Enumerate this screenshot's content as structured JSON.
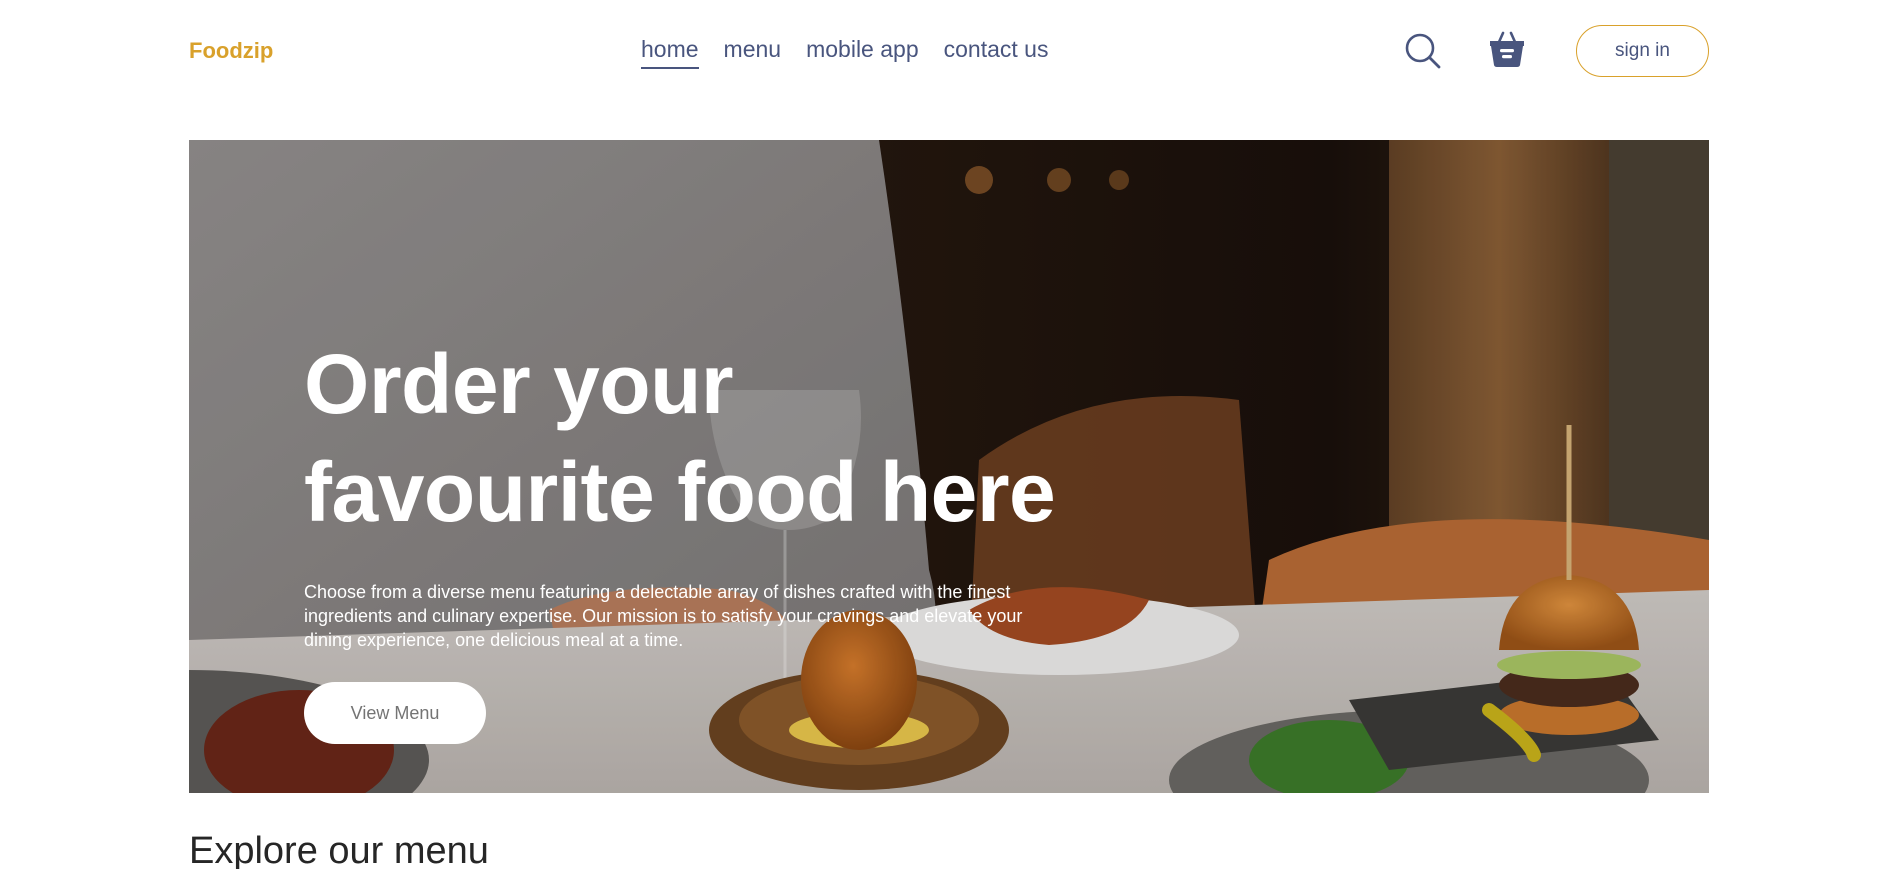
{
  "brand": {
    "logo": "Foodzip",
    "accent": "#d9a12b"
  },
  "nav": {
    "items": [
      {
        "label": "home",
        "active": true
      },
      {
        "label": "menu",
        "active": false
      },
      {
        "label": "mobile app",
        "active": false
      },
      {
        "label": "contact us",
        "active": false
      }
    ],
    "text_color": "#49557e"
  },
  "actions": {
    "search_icon": "search-icon",
    "basket_icon": "basket-icon",
    "signin_label": "sign in"
  },
  "hero": {
    "title_line1": "Order your",
    "title_line2": "favourite food here",
    "description": "Choose from a diverse menu featuring a delectable array of dishes crafted with the finest ingredients and culinary expertise. Our mission is to satisfy your cravings and elevate your dining experience, one delicious meal at a time.",
    "button_label": "View Menu"
  },
  "explore": {
    "title": "Explore our menu"
  }
}
